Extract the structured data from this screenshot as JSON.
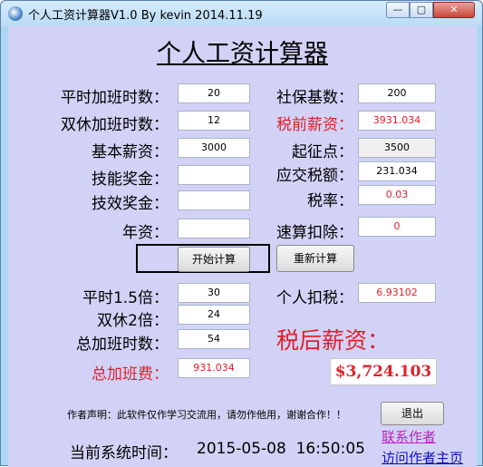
{
  "window": {
    "title": "个人工资计算器V1.0 By kevin 2014.11.19",
    "min_glyph": "—",
    "max_glyph": "▢",
    "close_glyph": "✕"
  },
  "heading": "个人工资计算器",
  "left_form": {
    "overtime_weekday_label": "平时加班时数：",
    "overtime_weekday_value": "20",
    "overtime_weekend_label": "双休加班时数：",
    "overtime_weekend_value": "12",
    "base_salary_label": "基本薪资：",
    "base_salary_value": "3000",
    "skill_bonus_label": "技能奖金：",
    "skill_bonus_value": "",
    "performance_bonus_label": "技效奖金：",
    "performance_bonus_value": "",
    "seniority_label": "年资：",
    "seniority_value": ""
  },
  "right_form": {
    "social_base_label": "社保基数：",
    "social_base_value": "200",
    "pretax_label": "税前薪资：",
    "pretax_value": "3931.034",
    "threshold_label": "起征点：",
    "threshold_value": "3500",
    "tax_payable_label": "应交税额：",
    "tax_payable_value": "231.034",
    "tax_rate_label": "税率：",
    "tax_rate_value": "0.03",
    "quick_deduction_label": "速算扣除：",
    "quick_deduction_value": "0"
  },
  "buttons": {
    "start": "开始计算",
    "recalc": "重新计算",
    "exit": "退出"
  },
  "results": {
    "weekday_15x_label": "平时1.5倍：",
    "weekday_15x_value": "30",
    "weekend_2x_label": "双休2倍：",
    "weekend_2x_value": "24",
    "total_hours_label": "总加班时数：",
    "total_hours_value": "54",
    "total_pay_label": "总加班费：",
    "total_pay_value": "931.034",
    "personal_tax_label": "个人扣税：",
    "personal_tax_value": "6.93102",
    "after_tax_label": "税后薪资：",
    "after_tax_value": "$3,724.103"
  },
  "footer": {
    "statement": "作者声明：此软件仅作学习交流用，请勿作他用，谢谢合作！！",
    "contact_link": "联系作者",
    "homepage_link": "访问作者主页",
    "time_label": "当前系统时间：",
    "time_value": "2015-05-08  16:50:05"
  },
  "colors": {
    "accent_red": "#e0202a",
    "client_bg": "#d2d2f6",
    "link_magenta": "#c020c0",
    "link_blue": "#1010c0"
  }
}
